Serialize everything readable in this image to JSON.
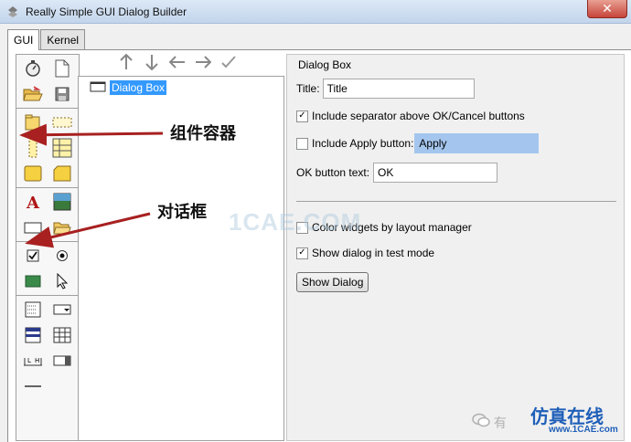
{
  "window": {
    "title": "Really Simple GUI Dialog Builder",
    "close_glyph": "✕"
  },
  "tabs": [
    {
      "label": "GUI"
    },
    {
      "label": "Kernel"
    }
  ],
  "palette": {
    "groups": [
      [
        "stopwatch-icon",
        "new-file-icon",
        "open-folder-icon",
        "save-icon"
      ],
      [
        "container-folder-icon",
        "dotted-frame-icon",
        "vertical-frame-icon",
        "grid-frame-icon",
        "yellow-folder-icon",
        "yellow-tab-icon"
      ],
      [
        "text-label-icon",
        "image-icon",
        "dialog-frame-icon",
        "open-dialog-icon"
      ],
      [
        "checkbox-icon",
        "radio-button-icon",
        "green-rectangle-icon",
        "cursor-icon"
      ],
      [
        "list-box-icon",
        "dropdown-icon",
        "colored-list-icon",
        "table-icon",
        "scale-icon",
        "spinner-icon",
        "separator-line-icon"
      ]
    ]
  },
  "toolbar": {
    "up": "↑",
    "down": "↓",
    "left": "←",
    "right": "→",
    "tool": "✓"
  },
  "tree": {
    "root_label": "Dialog Box"
  },
  "properties": {
    "group_title": "Dialog Box",
    "title_label": "Title:",
    "title_value": "Title",
    "separator_label": "Include separator above OK/Cancel buttons",
    "separator_checked": true,
    "apply_label": "Include Apply button:",
    "apply_checked": false,
    "apply_value": "Apply",
    "ok_label": "OK button text:",
    "ok_value": "OK",
    "color_widgets_label": "Color widgets by layout manager",
    "color_widgets_checked": false,
    "test_mode_label": "Show dialog in test mode",
    "test_mode_checked": true,
    "show_dialog_button": "Show Dialog"
  },
  "annotations": {
    "container_label": "组件容器",
    "dialog_label": "对话框",
    "watermark": "1CAE.COM",
    "brand": "仿真在线",
    "brand_url": "www.1CAE.com",
    "wechat": "有"
  },
  "colors": {
    "arrow": "#a82020",
    "selection": "#3399ff",
    "brand": "#1f5fb8"
  }
}
